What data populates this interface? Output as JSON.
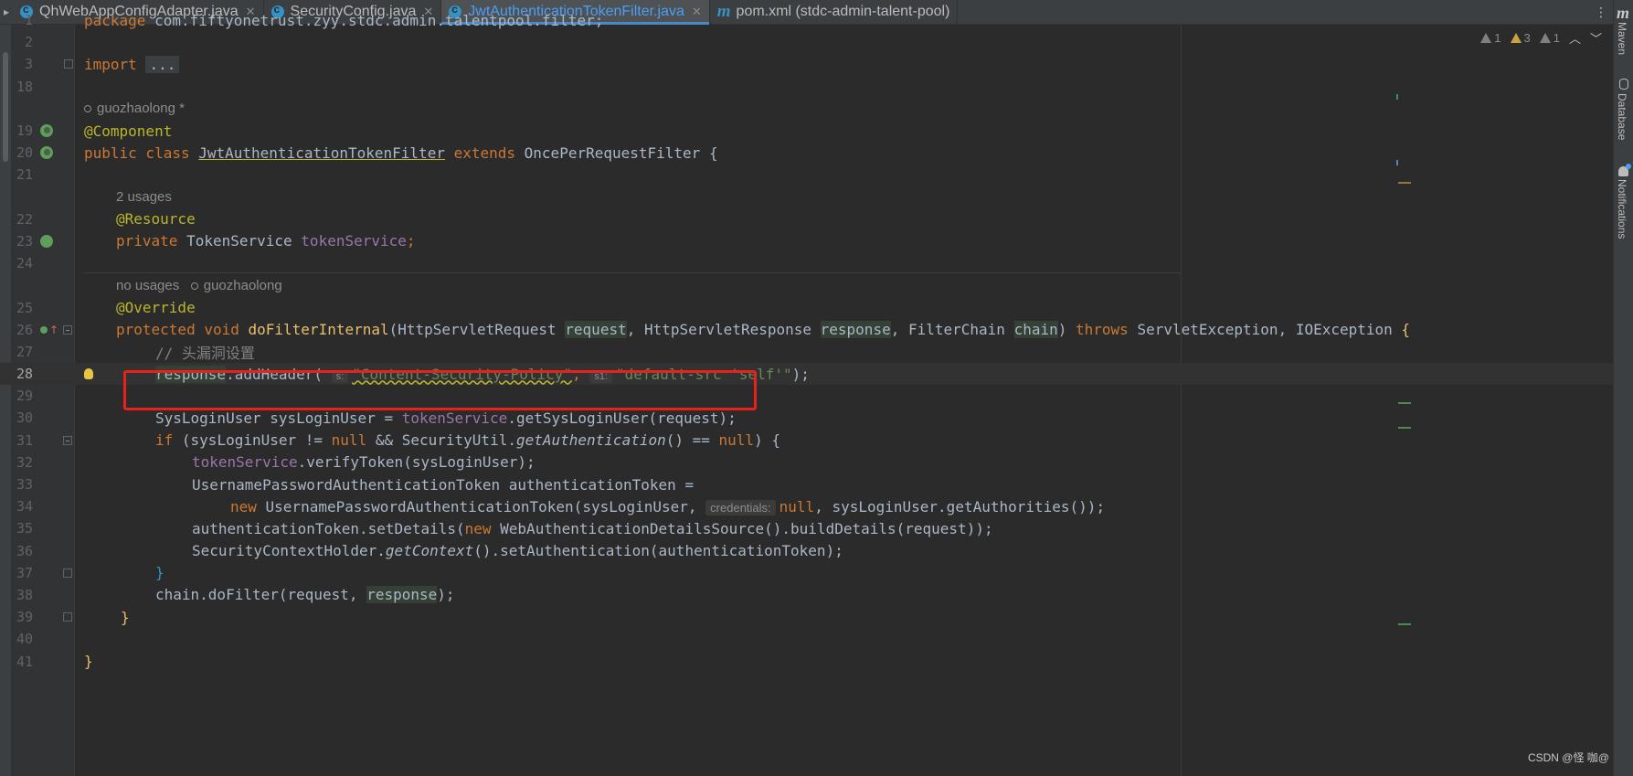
{
  "tabs": [
    {
      "label": "QhWebAppConfigAdapter.java",
      "icon": "java-class-icon",
      "active": false
    },
    {
      "label": "SecurityConfig.java",
      "icon": "java-class-icon",
      "active": false
    },
    {
      "label": "JwtAuthenticationTokenFilter.java",
      "icon": "java-class-icon",
      "active": true
    },
    {
      "label": "pom.xml (stdc-admin-talent-pool)",
      "icon": "maven-icon",
      "active": false
    }
  ],
  "right_panel": {
    "maven": "Maven",
    "database": "Database",
    "notifications": "Notifications"
  },
  "inspections": {
    "errors": "1",
    "warnings": "3",
    "weak": "1"
  },
  "editor": {
    "line_numbers": {
      "l1": "1",
      "l2": "2",
      "l3": "3",
      "l18": "18",
      "l19": "19",
      "l20": "20",
      "l21": "21",
      "l22": "22",
      "l23": "23",
      "l24": "24",
      "l25": "25",
      "l26": "26",
      "l27": "27",
      "l28": "28",
      "l29": "29",
      "l30": "30",
      "l31": "31",
      "l32": "32",
      "l33": "33",
      "l34": "34",
      "l35": "35",
      "l36": "36",
      "l37": "37",
      "l38": "38",
      "l39": "39",
      "l40": "40",
      "l41": "41"
    },
    "package_kw": "package",
    "package_name": " com.fiftyonetrust.zyy.stdc.admin.talentpool.filter;",
    "import_kw": "import",
    "import_folded": "...",
    "author1": "guozhaolong *",
    "annotation_component": "@Component",
    "class_decl": {
      "public_class": "public class ",
      "class_name": "JwtAuthenticationTokenFilter",
      "extends": " extends ",
      "super": "OncePerRequestFilter {"
    },
    "usages_2": "2 usages",
    "annotation_resource": "@Resource",
    "field_decl": {
      "private": "private ",
      "type": "TokenService ",
      "name": "tokenService",
      "end": ";"
    },
    "no_usages": "no usages",
    "author2": "guozhaolong",
    "annotation_override": "@Override",
    "method_decl": {
      "mods": "protected void ",
      "name": "doFilterInternal",
      "p1_type": "(HttpServletRequest ",
      "p1": "request",
      "p2_type": ", HttpServletResponse ",
      "p2": "response",
      "p3_type": ", FilterChain ",
      "p3": "chain",
      "rparen": ") ",
      "throws": "throws ",
      "exceptions": "ServletException, IOException ",
      "brace": "{"
    },
    "comment_header": "// 头漏洞设置",
    "line28": {
      "recv": "response",
      "call": ".addHeader(",
      "hint_s": "s:",
      "arg1": "\"Content-Security-Policy\"",
      "comma": ", ",
      "hint_s1": "s1:",
      "arg2": "\"default-src 'self'\"",
      "end": ");"
    },
    "line30": {
      "decl": "SysLoginUser sysLoginUser = ",
      "field": "tokenService",
      "rest": ".getSysLoginUser(request);"
    },
    "line31": {
      "if": "if ",
      "cond1": "(sysLoginUser != ",
      "null1": "null",
      "and": " && SecurityUtil.",
      "getauth": "getAuthentication",
      "paren": "() == ",
      "null2": "null",
      "close": ") {"
    },
    "line32": {
      "field": "tokenService",
      "rest": ".verifyToken(sysLoginUser);"
    },
    "line33": "UsernamePasswordAuthenticationToken authenticationToken =",
    "line34": {
      "new": "new ",
      "ctor": "UsernamePasswordAuthenticationToken(sysLoginUser, ",
      "hint": "credentials:",
      "null": "null",
      "rest": ", sysLoginUser.getAuthorities());"
    },
    "line35": {
      "pre": "authenticationToken.setDetails(",
      "new": "new ",
      "rest": "WebAuthenticationDetailsSource().buildDetails(request));"
    },
    "line36": {
      "pre": "SecurityContextHolder.",
      "getctx": "getContext",
      "rest": "().setAuthentication(authenticationToken);"
    },
    "line37": "}",
    "line38": {
      "pre": "chain.doFilter(request, ",
      "resp": "response",
      "end": ");"
    },
    "line39": "}",
    "line41": "}"
  },
  "watermark": "CSDN @怪 咖@"
}
